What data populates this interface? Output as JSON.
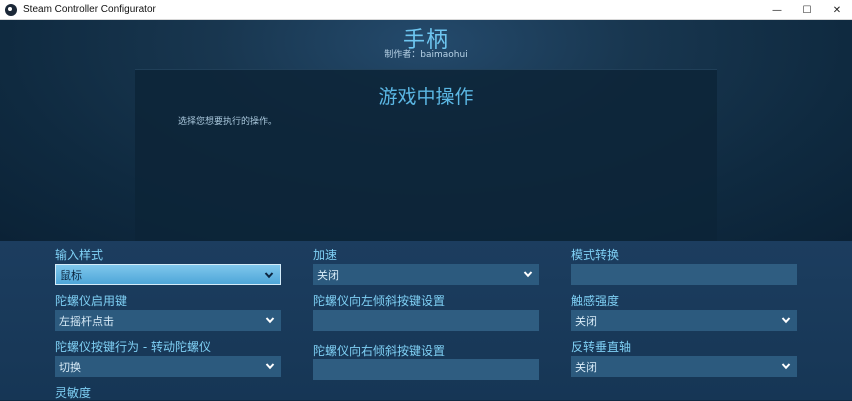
{
  "window": {
    "title": "Steam Controller Configurator",
    "minimize_glyph": "—",
    "maximize_glyph": "☐",
    "close_glyph": "✕"
  },
  "header": {
    "controller_name": "手柄",
    "author_label": "制作者：",
    "author_name": "baimaohui"
  },
  "panel": {
    "title": "游戏中操作",
    "subtitle": "选择您想要执行的操作。"
  },
  "settings": {
    "col1": {
      "input_style_label": "输入样式",
      "input_style_value": "鼠标",
      "gyro_enable_label": "陀螺仪启用键",
      "gyro_enable_value": "左摇杆点击",
      "gyro_button_behavior_label": "陀螺仪按键行为 - 转动陀螺仪",
      "gyro_button_behavior_value": "切换",
      "sensitivity_label": "灵敏度"
    },
    "col2": {
      "acceleration_label": "加速",
      "acceleration_value": "关闭",
      "gyro_tilt_left_label": "陀螺仪向左倾斜按键设置",
      "gyro_tilt_right_label": "陀螺仪向右倾斜按键设置"
    },
    "col3": {
      "mode_shift_label": "模式转换",
      "haptic_intensity_label": "触感强度",
      "haptic_intensity_value": "关闭",
      "invert_vertical_label": "反转垂直轴",
      "invert_vertical_value": "关闭"
    }
  },
  "icons": {
    "app": "steam-icon",
    "dropdown": "chevron-down-icon"
  }
}
